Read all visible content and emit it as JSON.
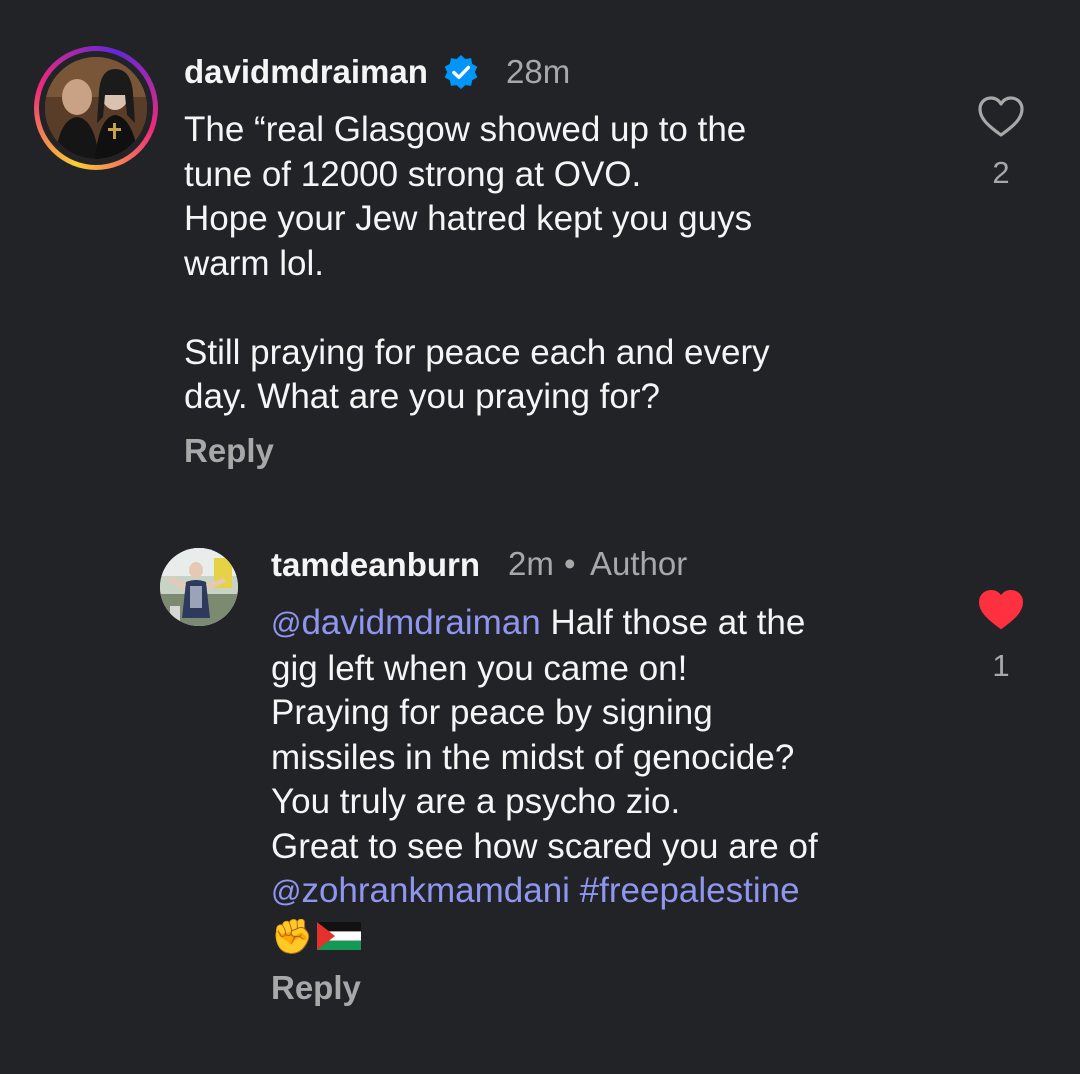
{
  "comments": [
    {
      "username": "davidmdraiman",
      "verified": true,
      "time": "28m",
      "lines": [
        "The “real Glasgow showed up to the",
        "tune of 12000 strong at OVO.",
        "Hope your Jew hatred kept you guys",
        "warm lol.",
        "",
        "Still praying for peace each and every",
        "day. What are you praying for?"
      ],
      "reply_label": "Reply",
      "likes": "2",
      "liked": false,
      "avatar_icon": "profile-photo"
    },
    {
      "username": "tamdeanburn",
      "time": "2m",
      "separator": "•",
      "author_badge": "Author",
      "mention_1": "davidmdraiman",
      "line_1_rest": " Half those at the",
      "line_2": "gig left when you came on!",
      "line_3": "Praying for peace by signing",
      "line_4": "missiles in the midst of genocide?",
      "line_5": "You truly are a psycho zio.",
      "line_6": "Great to see how scared you are of",
      "mention_2": "zohrankmamdani",
      "hashtag": "#freepalestine",
      "emoji_fist": "✊",
      "flag_icon": "palestine-flag",
      "reply_label": "Reply",
      "likes": "1",
      "liked": true,
      "avatar_icon": "profile-photo"
    }
  ],
  "mention_prefix": "@",
  "colors": {
    "background": "#222327",
    "text": "#f5f5f5",
    "secondary": "#a8a8a8",
    "mention": "#8e96f0",
    "like_active": "#ff3040",
    "verified": "#0095f6"
  }
}
